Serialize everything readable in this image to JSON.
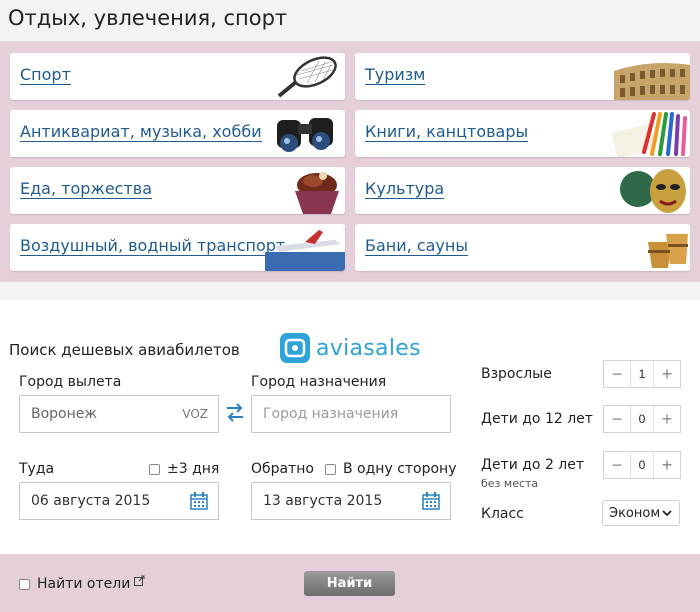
{
  "header": {
    "title": "Отдых, увлечения, спорт"
  },
  "categories": [
    {
      "label": "Спорт",
      "icon": "tennis-racket-icon"
    },
    {
      "label": "Туризм",
      "icon": "colosseum-icon"
    },
    {
      "label": "Антиквариат, музыка, хобби",
      "icon": "binoculars-icon"
    },
    {
      "label": "Книги, канцтовары",
      "icon": "pencils-icon"
    },
    {
      "label": "Еда, торжества",
      "icon": "cupcake-icon"
    },
    {
      "label": "Культура",
      "icon": "carnival-mask-icon"
    },
    {
      "label": "Воздушный, водный транспорт",
      "icon": "airplane-icon"
    },
    {
      "label": "Бани, сауны",
      "icon": "wooden-bucket-icon"
    }
  ],
  "search": {
    "title": "Поиск дешевых авиабилетов",
    "brand": "aviasales",
    "origin": {
      "label": "Город вылета",
      "value": "Воронеж",
      "code": "VOZ"
    },
    "destination": {
      "label": "Город назначения",
      "placeholder": "Город назначения"
    },
    "depart": {
      "label": "Туда",
      "flex_label": "±3 дня",
      "value": "06 августа 2015"
    },
    "return": {
      "label": "Обратно",
      "oneway_label": "В одну сторону",
      "value": "13 августа 2015"
    },
    "adults": {
      "label": "Взрослые",
      "value": "1"
    },
    "children": {
      "label": "Дети до 12 лет",
      "value": "0"
    },
    "infants": {
      "label": "Дети до 2 лет",
      "sub": "без места",
      "value": "0"
    },
    "class": {
      "label": "Класс",
      "value": "Эконом"
    }
  },
  "footer": {
    "hotels_label": "Найти отели",
    "find_button": "Найти"
  },
  "colors": {
    "pink_bg": "#e4cfda",
    "link": "#1f5b8f",
    "brand": "#2ea3d8"
  }
}
